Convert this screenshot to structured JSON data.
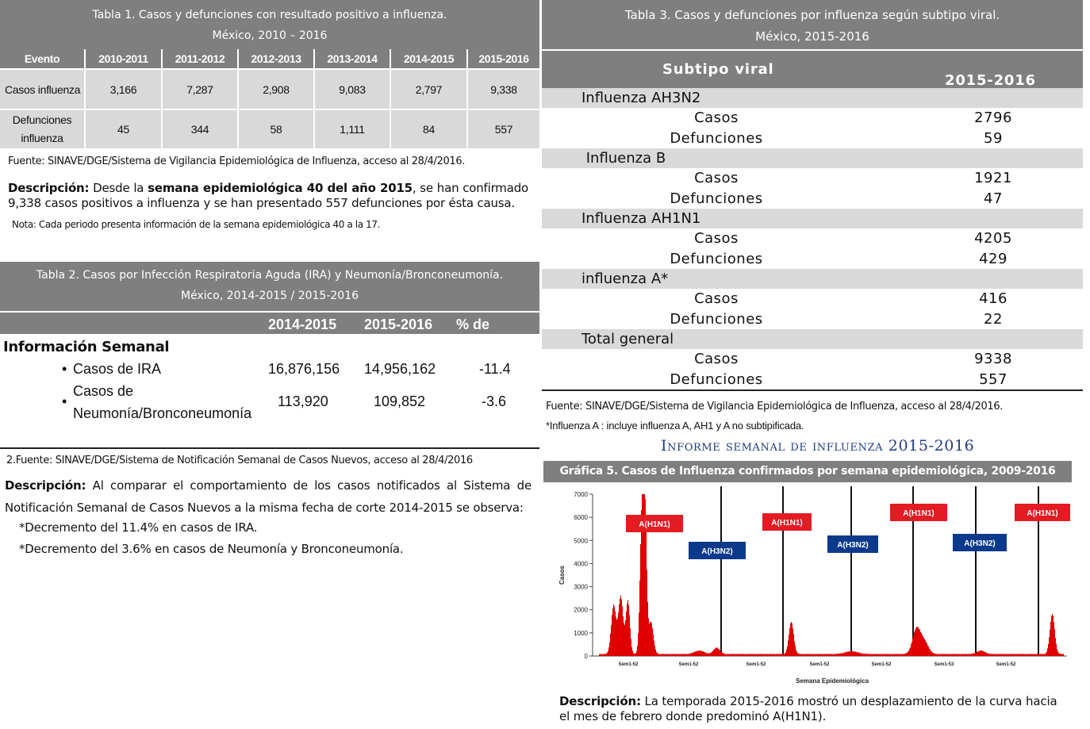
{
  "tabla1": {
    "title": "Tabla 1. Casos y defunciones con resultado positivo a influenza.",
    "subtitle": "México, 2010 – 2016",
    "headers": [
      "Evento",
      "2010-2011",
      "2011-2012",
      "2012-2013",
      "2013-2014",
      "2014-2015",
      "2015-2016"
    ],
    "rows": [
      {
        "label": "Casos influenza",
        "values": [
          "3,166",
          "7,287",
          "2,908",
          "9,083",
          "2,797",
          "9,338"
        ]
      },
      {
        "label_l1": "Defunciones",
        "label_l2": "influenza",
        "values": [
          "45",
          "344",
          "58",
          "1,111",
          "84",
          "557"
        ]
      }
    ],
    "fuente": "Fuente: SINAVE/DGE/Sistema de Vigilancia Epidemiológica de Influenza, acceso al 28/4/2016.",
    "desc_label": "Descripción:",
    "desc_a": " Desde la ",
    "desc_b": "semana epidemiológica 40 del año 2015",
    "desc_c": ", se han confirmado 9,338 casos positivos a influenza y  se han presentado 557 defunciones por ésta causa.",
    "nota": "Nota: Cada periodo presenta información de la semana epidemiológica 40 a la 17."
  },
  "tabla2": {
    "title": "Tabla 2. Casos por Infección Respiratoria Aguda (IRA) y Neumonía/Bronconeumonía.",
    "subtitle": "México, 2014-2015 / 2015-2016",
    "headers": [
      "2014-2015",
      "2015-2016",
      "% de cambio"
    ],
    "section": "Información Semanal",
    "rows": [
      {
        "label": "Casos de IRA",
        "values": [
          "16,876,156",
          "14,956,162",
          "-11.4"
        ]
      },
      {
        "label_l1": "Casos de",
        "label_l2": "Neumonía/Bronconeumonía",
        "values": [
          "113,920",
          "109,852",
          "-3.6"
        ]
      }
    ],
    "fuente": "2.Fuente: SINAVE/DGE/Sistema de Notificación Semanal de Casos Nuevos, acceso al 28/4/2016",
    "desc_label": "Descripción:",
    "desc": " Al comparar el comportamiento de los casos notificados al Sistema de Notificación Semanal de Casos Nuevos a la misma fecha de corte 2014-2015 se observa:",
    "bullet1": "*Decremento del 11.4% en casos de IRA.",
    "bullet2": "*Decremento del 3.6% en casos de Neumonía y Bronconeumonía."
  },
  "tabla3": {
    "title": "Tabla 3. Casos y defunciones por influenza según subtipo viral.",
    "subtitle": "México, 2015-2016",
    "col1": "Subtipo viral",
    "col2": "2015-2016",
    "groups": [
      {
        "name": "Influenza AH3N2",
        "casos_label": "Casos",
        "casos": "2796",
        "def_label": "Defunciones",
        "def": "59"
      },
      {
        "name": " Influenza B",
        "casos_label": "Casos",
        "casos": "1921",
        "def_label": "Defunciones",
        "def": "47"
      },
      {
        "name": "Influenza AH1N1",
        "casos_label": "Casos",
        "casos": "4205",
        "def_label": "Defunciones",
        "def": "429"
      },
      {
        "name": "influenza A*",
        "casos_label": "Casos",
        "casos": "416",
        "def_label": "Defunciones",
        "def": "22"
      },
      {
        "name": "Total general",
        "casos_label": "Casos",
        "casos": "9338",
        "def_label": "Defunciones",
        "def": "557"
      }
    ],
    "fuente": "Fuente: SINAVE/DGE/Sistema de Vigilancia Epidemiológica de Influenza, acceso al 28/4/2016.",
    "nota": "*Influenza A : incluye influenza A, AH1 y A no subtipificada.",
    "informe": "Informe semanal de influenza 2015-2016"
  },
  "grafica5": {
    "title": "Gráfica 5. Casos de Influenza confirmados por semana epidemiológica, 2009-2016",
    "desc_label": "Descripción:",
    "desc": " La temporada 2015-2016 mostró un desplazamiento de la curva hacia el mes de febrero donde predominó A(H1N1).",
    "colors": {
      "bar": "#e00000",
      "h1n1": "#e31b23",
      "h3n2": "#0b3a8c",
      "header": "#7f7f7f"
    }
  },
  "chart_data": {
    "type": "bar",
    "title": "Gráfica 5. Casos de Influenza confirmados por semana epidemiológica, 2009-2016",
    "xlabel": "Semana Epidemiológica",
    "ylabel": "Casos",
    "ylim": [
      0,
      7000
    ],
    "yticks": [
      0,
      1000,
      2000,
      3000,
      4000,
      5000,
      6000,
      7000
    ],
    "xticks": [
      "Sem1-52",
      "Sem1-52",
      "Sem1-52",
      "Sem1-52",
      "Sem1-52",
      "Sem1-53",
      "Sem1-52"
    ],
    "grid": false,
    "legend": "none",
    "season_labels": [
      {
        "label": "A(H1N1)",
        "color": "#e31b23"
      },
      {
        "label": "A(H3N2)",
        "color": "#0b3a8c"
      },
      {
        "label": "A(H1N1)",
        "color": "#e31b23"
      },
      {
        "label": "A(H3N2)",
        "color": "#0b3a8c"
      },
      {
        "label": "A(H1N1)",
        "color": "#e31b23"
      },
      {
        "label": "A(H3N2)",
        "color": "#0b3a8c"
      },
      {
        "label": "A(H1N1)",
        "color": "#e31b23"
      }
    ],
    "peaks_approx": [
      {
        "season": "2009",
        "max": 6800
      },
      {
        "season": "2012",
        "max": 1500
      },
      {
        "season": "2013-2014",
        "max": 1100
      },
      {
        "season": "2015-2016",
        "max": 1800
      }
    ]
  }
}
